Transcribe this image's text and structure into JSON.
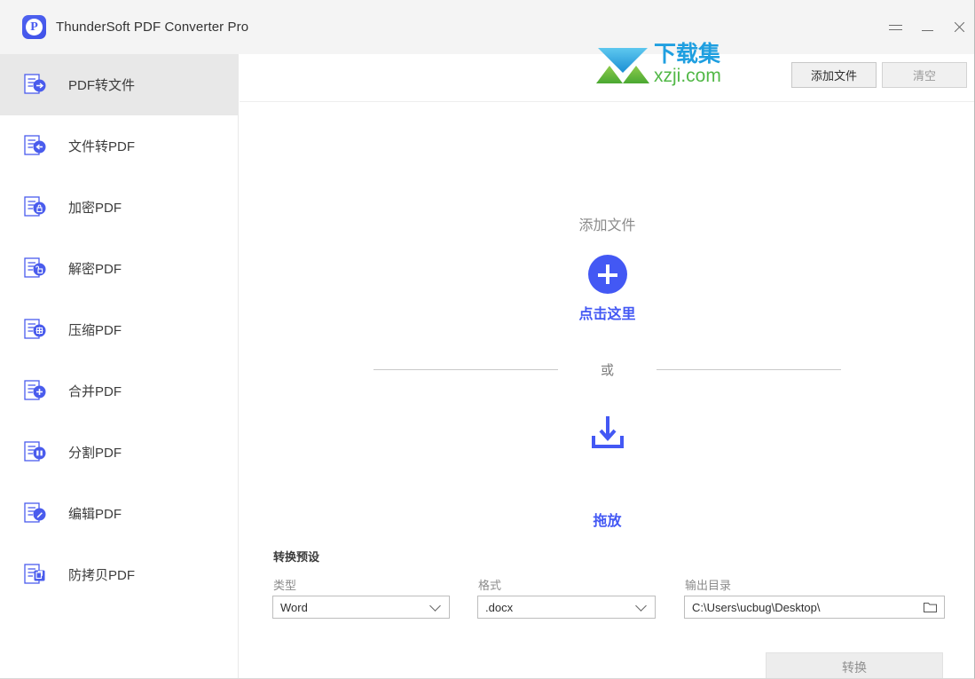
{
  "window": {
    "title": "ThunderSoft PDF Converter Pro",
    "logo_letter": "P",
    "controls": {
      "menu": "menu-icon",
      "minimize": "minimize-icon",
      "close": "close-icon"
    }
  },
  "sidebar": {
    "items": [
      {
        "label": "PDF转文件",
        "icon": "doc-arrow-right-icon",
        "active": true
      },
      {
        "label": "文件转PDF",
        "icon": "doc-arrow-left-icon",
        "active": false
      },
      {
        "label": "加密PDF",
        "icon": "doc-lock-icon",
        "active": false
      },
      {
        "label": "解密PDF",
        "icon": "doc-unlock-icon",
        "active": false
      },
      {
        "label": "压缩PDF",
        "icon": "doc-compress-icon",
        "active": false
      },
      {
        "label": "合并PDF",
        "icon": "doc-plus-icon",
        "active": false
      },
      {
        "label": "分割PDF",
        "icon": "doc-split-icon",
        "active": false
      },
      {
        "label": "编辑PDF",
        "icon": "doc-edit-icon",
        "active": false
      },
      {
        "label": "防拷贝PDF",
        "icon": "doc-copyguard-icon",
        "active": false
      }
    ]
  },
  "header": {
    "watermark": {
      "cn": "下载集",
      "en": "xzji.com"
    },
    "add_files_label": "添加文件",
    "clear_label": "清空"
  },
  "dropzone": {
    "add_title": "添加文件",
    "click_here": "点击这里",
    "or": "或",
    "drop": "拖放"
  },
  "settings": {
    "preset_title": "转换预设",
    "type_label": "类型",
    "type_value": "Word",
    "format_label": "格式",
    "format_value": ".docx",
    "output_label": "输出目录",
    "output_value": "C:\\Users\\ucbug\\Desktop\\",
    "convert_label": "转换"
  },
  "colors": {
    "accent_blue": "#4358f4",
    "icon_blue": "#4a5ced",
    "watermark_blue": "#1f9fe0",
    "watermark_green": "#52b847",
    "sidebar_active": "#e8e8e8",
    "titlebar": "#f4f4f4"
  }
}
